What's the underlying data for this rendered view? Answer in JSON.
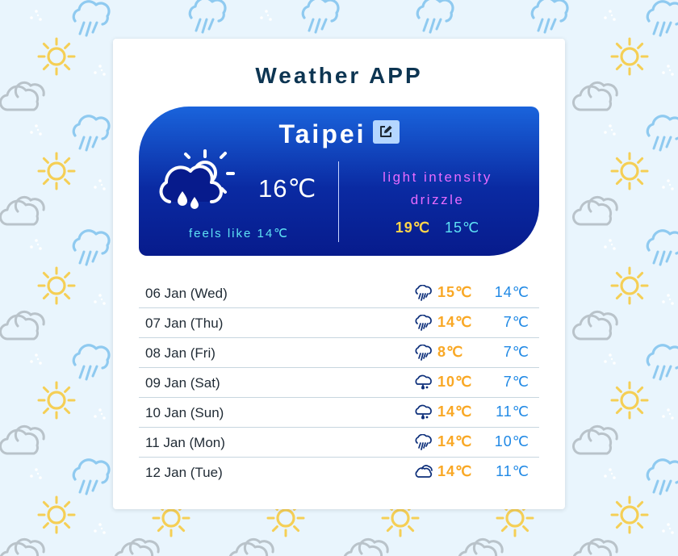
{
  "app": {
    "title": "Weather APP"
  },
  "current": {
    "city": "Taipei",
    "temperature": "16℃",
    "feels_like": "feels like 14℃",
    "description_line1": "light intensity",
    "description_line2": "drizzle",
    "high": "19℃",
    "low": "15℃",
    "icon": "sun-cloud-rain-icon"
  },
  "icons": {
    "edit": "edit-icon",
    "background": [
      "rain-cloud-icon",
      "sun-icon",
      "cloud-icon",
      "sparkle-icon"
    ]
  },
  "colors": {
    "background": "#e9f5fd",
    "card": "#ffffff",
    "title": "#0d3552",
    "panel_top": "#1a64dc",
    "panel_bottom": "#071b8c",
    "description": "#e86bff",
    "feels_like": "#5ee2f5",
    "high_current": "#ffd54a",
    "forecast_high": "#f9a825",
    "forecast_low": "#1e88e5"
  },
  "forecast": [
    {
      "date": "06 Jan (Wed)",
      "icon": "rain-icon",
      "high": "15℃",
      "low": "14℃"
    },
    {
      "date": "07 Jan (Thu)",
      "icon": "rain-icon",
      "high": "14℃",
      "low": "7℃"
    },
    {
      "date": "08 Jan (Fri)",
      "icon": "rain-icon",
      "high": "8℃",
      "low": "7℃"
    },
    {
      "date": "09 Jan (Sat)",
      "icon": "drizzle-icon",
      "high": "10℃",
      "low": "7℃"
    },
    {
      "date": "10 Jan (Sun)",
      "icon": "drizzle-icon",
      "high": "14℃",
      "low": "11℃"
    },
    {
      "date": "11 Jan (Mon)",
      "icon": "rain-icon",
      "high": "14℃",
      "low": "10℃"
    },
    {
      "date": "12 Jan (Tue)",
      "icon": "cloud-icon",
      "high": "14℃",
      "low": "11℃"
    }
  ]
}
